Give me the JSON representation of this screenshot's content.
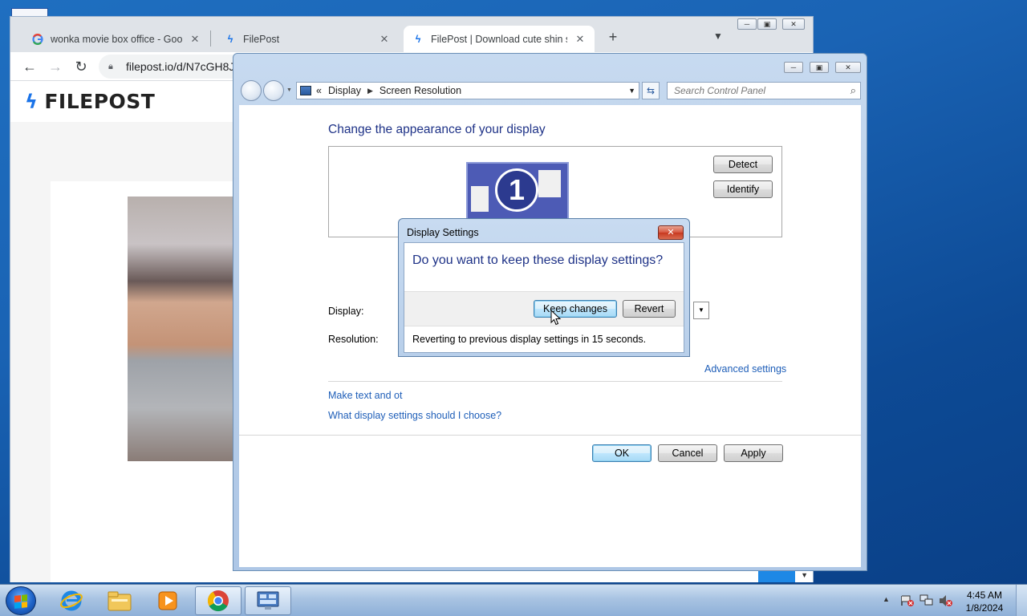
{
  "browser": {
    "tabs": [
      {
        "title": "wonka movie box office - Google",
        "favicon": "google-icon",
        "active": false
      },
      {
        "title": "FilePost",
        "favicon": "bolt-icon",
        "active": false
      },
      {
        "title": "FilePost | Download cute shin se",
        "favicon": "bolt-icon",
        "active": true
      }
    ],
    "new_tab": "+",
    "url": "filepost.io/d/N7cGH8J",
    "site": {
      "logo_text": "FILEPOST",
      "accent": "#1a73e8"
    }
  },
  "control_panel": {
    "breadcrumb": [
      "Display",
      "Screen Resolution"
    ],
    "breadcrumb_prefix": "«",
    "search_placeholder": "Search Control Panel",
    "heading": "Change the appearance of your display",
    "monitor_number": "1",
    "detect_label": "Detect",
    "identify_label": "Identify",
    "display_label": "Display:",
    "resolution_label": "Resolution:",
    "advanced_link": "Advanced settings",
    "make_text_link": "Make text and ot",
    "which_settings_link": "What display settings should I choose?",
    "ok_label": "OK",
    "cancel_label": "Cancel",
    "apply_label": "Apply"
  },
  "dialog": {
    "title": "Display Settings",
    "question": "Do you want to keep these display settings?",
    "keep_label": "Keep changes",
    "revert_label": "Revert",
    "footer": "Reverting to previous display settings in 15 seconds."
  },
  "taskbar": {
    "apps": [
      "ie-icon",
      "explorer-icon",
      "media-player-icon",
      "chrome-icon",
      "control-panel-icon"
    ],
    "time": "4:45 AM",
    "date": "1/8/2024"
  }
}
